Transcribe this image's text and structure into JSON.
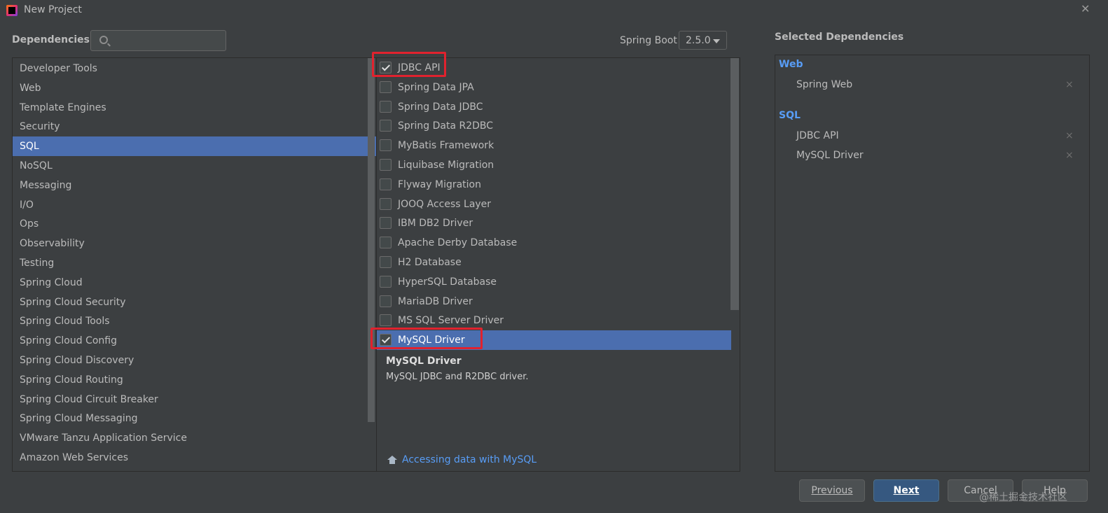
{
  "window": {
    "title": "New Project",
    "close_icon": "✕"
  },
  "header": {
    "dependencies_label": "Dependencies",
    "search_value": "",
    "spring_boot_label": "Spring Boot",
    "spring_boot_version": "2.5.0"
  },
  "categories": [
    "Developer Tools",
    "Web",
    "Template Engines",
    "Security",
    "SQL",
    "NoSQL",
    "Messaging",
    "I/O",
    "Ops",
    "Observability",
    "Testing",
    "Spring Cloud",
    "Spring Cloud Security",
    "Spring Cloud Tools",
    "Spring Cloud Config",
    "Spring Cloud Discovery",
    "Spring Cloud Routing",
    "Spring Cloud Circuit Breaker",
    "Spring Cloud Messaging",
    "VMware Tanzu Application Service",
    "Amazon Web Services"
  ],
  "selected_category": "SQL",
  "dependencies": [
    {
      "label": "JDBC API",
      "checked": true
    },
    {
      "label": "Spring Data JPA",
      "checked": false
    },
    {
      "label": "Spring Data JDBC",
      "checked": false
    },
    {
      "label": "Spring Data R2DBC",
      "checked": false
    },
    {
      "label": "MyBatis Framework",
      "checked": false
    },
    {
      "label": "Liquibase Migration",
      "checked": false
    },
    {
      "label": "Flyway Migration",
      "checked": false
    },
    {
      "label": "JOOQ Access Layer",
      "checked": false
    },
    {
      "label": "IBM DB2 Driver",
      "checked": false
    },
    {
      "label": "Apache Derby Database",
      "checked": false
    },
    {
      "label": "H2 Database",
      "checked": false
    },
    {
      "label": "HyperSQL Database",
      "checked": false
    },
    {
      "label": "MariaDB Driver",
      "checked": false
    },
    {
      "label": "MS SQL Server Driver",
      "checked": false
    },
    {
      "label": "MySQL Driver",
      "checked": true
    }
  ],
  "selected_dependency": "MySQL Driver",
  "description": {
    "title": "MySQL Driver",
    "text": "MySQL JDBC and R2DBC driver.",
    "link": "Accessing data with MySQL"
  },
  "selected_panel": {
    "title": "Selected Dependencies",
    "groups": [
      {
        "name": "Web",
        "items": [
          "Spring Web"
        ]
      },
      {
        "name": "SQL",
        "items": [
          "JDBC API",
          "MySQL Driver"
        ]
      }
    ],
    "remove_icon": "×"
  },
  "buttons": {
    "previous": "Previous",
    "next": "Next",
    "cancel": "Cancel",
    "help": "Help"
  },
  "watermark": "@稀土掘金技术社区",
  "colors": {
    "background": "#3c3f41",
    "selection": "#4b6eaf",
    "link": "#589df6",
    "highlight_box": "#e0222e",
    "primary_button": "#365880"
  }
}
